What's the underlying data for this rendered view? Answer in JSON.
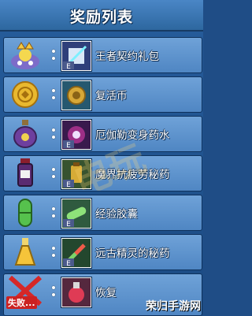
{
  "title": "奖励列表",
  "rewards": [
    {
      "name": "王者契约礼包",
      "icon": "king-contract-gift-icon"
    },
    {
      "name": "复活币",
      "icon": "revival-coin-icon"
    },
    {
      "name": "厄伽勒变身药水",
      "icon": "transform-potion-icon"
    },
    {
      "name": "魔界抗疲劳秘药",
      "icon": "anti-fatigue-elixir-icon"
    },
    {
      "name": "经验胶囊",
      "icon": "exp-capsule-icon"
    },
    {
      "name": "远古精灵的秘药",
      "icon": "elf-elixir-icon"
    },
    {
      "name": "恢复",
      "icon": "recovery-potion-icon"
    }
  ],
  "fail_badge": "失败...",
  "watermark": "电玩",
  "site_mark": "荣归手游网",
  "colors": {
    "panel": "#265d9c",
    "row": "#5f95cf",
    "text": "#ffffff"
  }
}
